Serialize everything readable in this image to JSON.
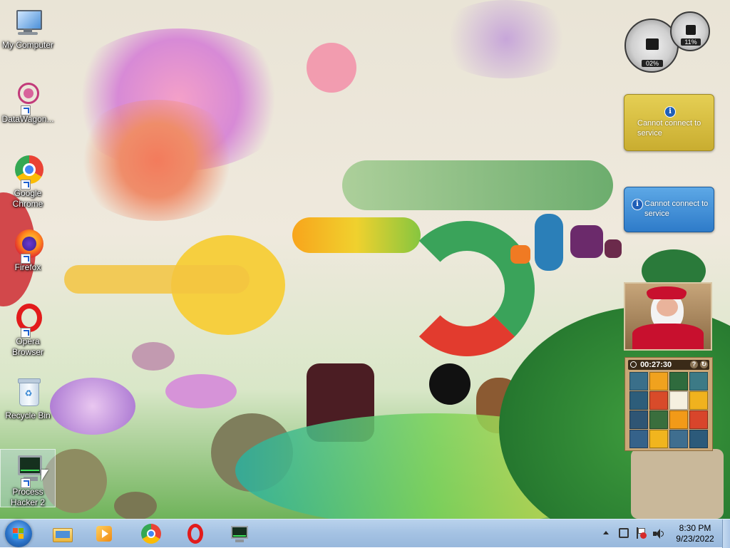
{
  "desktop": {
    "icons": [
      {
        "label": "My Computer",
        "icon": "computer-icon"
      },
      {
        "label": "DataWagon...",
        "icon": "datawagon-icon"
      },
      {
        "label": "Google Chrome",
        "icon": "chrome-icon"
      },
      {
        "label": "Firefox",
        "icon": "firefox-icon"
      },
      {
        "label": "Opera Browser",
        "icon": "opera-icon"
      },
      {
        "label": "Recycle Bin",
        "icon": "recycle-bin-icon"
      },
      {
        "label": "Process Hacker 2",
        "icon": "process-hacker-icon"
      }
    ]
  },
  "gadgets": {
    "cpu_meter": {
      "cpu": "02%",
      "memory": "11%"
    },
    "weather": {
      "message": "Cannot connect to service"
    },
    "feed": {
      "message": "Cannot connect to service"
    },
    "puzzle": {
      "timer": "00:27:30"
    }
  },
  "taskbar": {
    "pinned": [
      "explorer-icon",
      "media-player-icon",
      "chrome-icon",
      "opera-icon",
      "process-hacker-icon"
    ],
    "clock": {
      "time": "8:30 PM",
      "date": "9/23/2022"
    }
  }
}
